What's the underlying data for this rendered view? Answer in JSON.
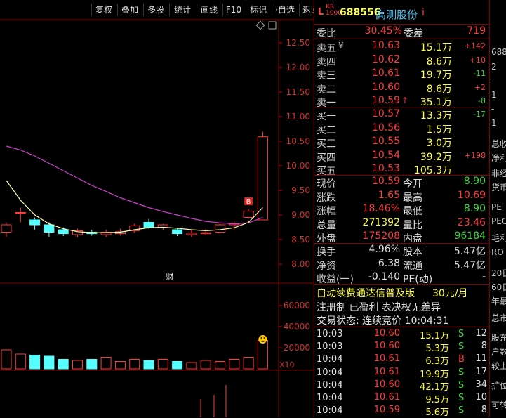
{
  "toolbar": {
    "buttons": [
      "复权",
      "叠加",
      "多股",
      "统计",
      "画线",
      "F10",
      "标记",
      "·自选",
      "返回"
    ]
  },
  "chart": {
    "price_axis": [
      "12.50",
      "12.00",
      "11.50",
      "11.00",
      "10.50",
      "10.00",
      "9.50",
      "9.00",
      "8.50",
      "8.00"
    ],
    "volume_axis": [
      "60000",
      "40000",
      "20000"
    ],
    "volume_unit": "X10",
    "finance_marker": "财",
    "buy_marker": "B",
    "candles": [
      {
        "o": 8.65,
        "c": 8.8,
        "h": 8.85,
        "l": 8.55,
        "v": 18000
      },
      {
        "o": 9.05,
        "c": 9.05,
        "h": 9.15,
        "l": 8.85,
        "v": 14000
      },
      {
        "o": 8.9,
        "c": 8.8,
        "h": 8.95,
        "l": 8.7,
        "v": 13000
      },
      {
        "o": 8.8,
        "c": 8.65,
        "h": 8.85,
        "l": 8.55,
        "v": 12000
      },
      {
        "o": 8.7,
        "c": 8.62,
        "h": 8.75,
        "l": 8.57,
        "v": 9000
      },
      {
        "o": 8.6,
        "c": 8.68,
        "h": 8.72,
        "l": 8.55,
        "v": 8000
      },
      {
        "o": 8.65,
        "c": 8.62,
        "h": 8.7,
        "l": 8.58,
        "v": 9000
      },
      {
        "o": 8.6,
        "c": 8.65,
        "h": 8.7,
        "l": 8.55,
        "v": 11000
      },
      {
        "o": 8.62,
        "c": 8.66,
        "h": 8.72,
        "l": 8.58,
        "v": 7000
      },
      {
        "o": 8.68,
        "c": 8.78,
        "h": 8.82,
        "l": 8.64,
        "v": 9000
      },
      {
        "o": 8.85,
        "c": 8.75,
        "h": 8.92,
        "l": 8.72,
        "v": 8000
      },
      {
        "o": 8.75,
        "c": 8.8,
        "h": 8.82,
        "l": 8.7,
        "v": 9000
      },
      {
        "o": 8.7,
        "c": 8.62,
        "h": 8.74,
        "l": 8.57,
        "v": 7000
      },
      {
        "o": 8.6,
        "c": 8.63,
        "h": 8.7,
        "l": 8.55,
        "v": 6000
      },
      {
        "o": 8.62,
        "c": 8.64,
        "h": 8.72,
        "l": 8.58,
        "v": 8000
      },
      {
        "o": 8.65,
        "c": 8.8,
        "h": 8.82,
        "l": 8.62,
        "v": 7000
      },
      {
        "o": 8.8,
        "c": 8.82,
        "h": 8.88,
        "l": 8.7,
        "v": 9000
      },
      {
        "o": 8.95,
        "c": 9.08,
        "h": 9.12,
        "l": 8.92,
        "v": 11000
      },
      {
        "o": 8.9,
        "c": 10.59,
        "h": 10.69,
        "l": 8.9,
        "v": 27000
      }
    ],
    "ma_long": [
      10.4,
      10.32,
      10.2,
      10.05,
      9.9,
      9.75,
      9.6,
      9.48,
      9.35,
      9.25,
      9.15,
      9.07,
      9.0,
      8.93,
      8.87,
      8.84,
      8.82,
      8.84,
      8.95
    ],
    "ma_short": [
      9.7,
      9.3,
      9.0,
      8.82,
      8.72,
      8.66,
      8.64,
      8.64,
      8.65,
      8.7,
      8.74,
      8.75,
      8.73,
      8.7,
      8.68,
      8.7,
      8.74,
      8.85,
      9.15
    ]
  },
  "quote": {
    "market_tag": "L",
    "kcb_tag_top": "KR",
    "kcb_tag_bottom": "1000",
    "code": "688556",
    "name": "高测股份",
    "info_icon": "i",
    "weibi_label": "委比",
    "weibi_value": "30.45%",
    "weicha_label": "委差",
    "weicha_value": "719",
    "asks": [
      {
        "label": "卖五",
        "flag": "¥",
        "price": "10.63",
        "vol": "15.1万",
        "chg": "+142"
      },
      {
        "label": "卖四",
        "flag": "",
        "price": "10.62",
        "vol": "8.6万",
        "chg": "+10"
      },
      {
        "label": "卖三",
        "flag": "",
        "price": "10.61",
        "vol": "19.7万",
        "chg": "-11"
      },
      {
        "label": "卖二",
        "flag": "",
        "price": "10.60",
        "vol": "8.6万",
        "chg": "+2"
      },
      {
        "label": "卖一",
        "flag": "",
        "price": "10.59",
        "arrow": "↑",
        "vol": "35.1万",
        "chg": "-8"
      }
    ],
    "bids": [
      {
        "label": "买一",
        "price": "10.57",
        "vol": "13.3万",
        "chg": "-17"
      },
      {
        "label": "买二",
        "price": "10.56",
        "vol": "1.5万",
        "chg": ""
      },
      {
        "label": "买三",
        "price": "10.55",
        "vol": "3.0万",
        "chg": ""
      },
      {
        "label": "买四",
        "price": "10.54",
        "vol": "39.2万",
        "chg": "+198"
      },
      {
        "label": "买五",
        "price": "10.53",
        "vol": "105.3万",
        "chg": ""
      }
    ],
    "stats": [
      {
        "l1": "现价",
        "v1": "10.59",
        "l2": "今开",
        "v2": "8.90",
        "c1": "red",
        "c2": "green"
      },
      {
        "l1": "涨跌",
        "v1": "1.65",
        "l2": "最高",
        "v2": "10.69",
        "c1": "red",
        "c2": "red"
      },
      {
        "l1": "涨幅",
        "v1": "18.46%",
        "l2": "最低",
        "v2": "8.90",
        "c1": "red",
        "c2": "green"
      },
      {
        "l1": "总量",
        "v1": "271392",
        "l2": "量比",
        "v2": "23.46",
        "c1": "yellow",
        "c2": "red"
      },
      {
        "l1": "外盘",
        "v1": "175208",
        "l2": "内盘",
        "v2": "96184",
        "c1": "red",
        "c2": "green"
      }
    ],
    "fund": [
      {
        "l1": "换手",
        "v1": "4.96%",
        "l2": "股本",
        "v2": "5.47亿"
      },
      {
        "l1": "净资",
        "v1": "6.38",
        "l2": "流通",
        "v2": "5.47亿"
      },
      {
        "l1": "收益(一)",
        "v1": "-0.140",
        "l2": "PE(动)",
        "v2": "-"
      }
    ],
    "ad_text": "自动续费通达信普及版",
    "ad_price": "30元/月",
    "reg_text": "注册制 已盈利 表决权无差异",
    "status_text": "交易状态: 连续竞价 10:04:31",
    "ticks": [
      {
        "t": "10:03",
        "p": "10.60",
        "v": "15.1万",
        "s": "S",
        "n": "12"
      },
      {
        "t": "10:03",
        "p": "10.60",
        "v": "5.3万",
        "s": "S",
        "n": "8"
      },
      {
        "t": "10:04",
        "p": "10.61",
        "v": "6.3万",
        "s": "B",
        "n": "11"
      },
      {
        "t": "10:04",
        "p": "10.61",
        "v": "19.9万",
        "s": "S",
        "n": "17"
      },
      {
        "t": "10:04",
        "p": "10.60",
        "v": "42.1万",
        "s": "S",
        "n": "34"
      },
      {
        "t": "10:04",
        "p": "10.61",
        "v": "9.5万",
        "s": "S",
        "n": "10"
      },
      {
        "t": "10:04",
        "p": "10.59",
        "v": "5.6万",
        "s": "S",
        "n": "8"
      }
    ]
  },
  "edge": [
    "688",
    "2",
    "-",
    "1",
    "-",
    "1",
    "总收",
    "净利",
    "非经",
    "货币",
    "PE",
    "PEG",
    "毛利",
    "RO",
    "20日",
    "60日",
    "年最",
    "总市",
    "股东",
    "户数",
    "较上",
    "扩位",
    "可转"
  ]
}
